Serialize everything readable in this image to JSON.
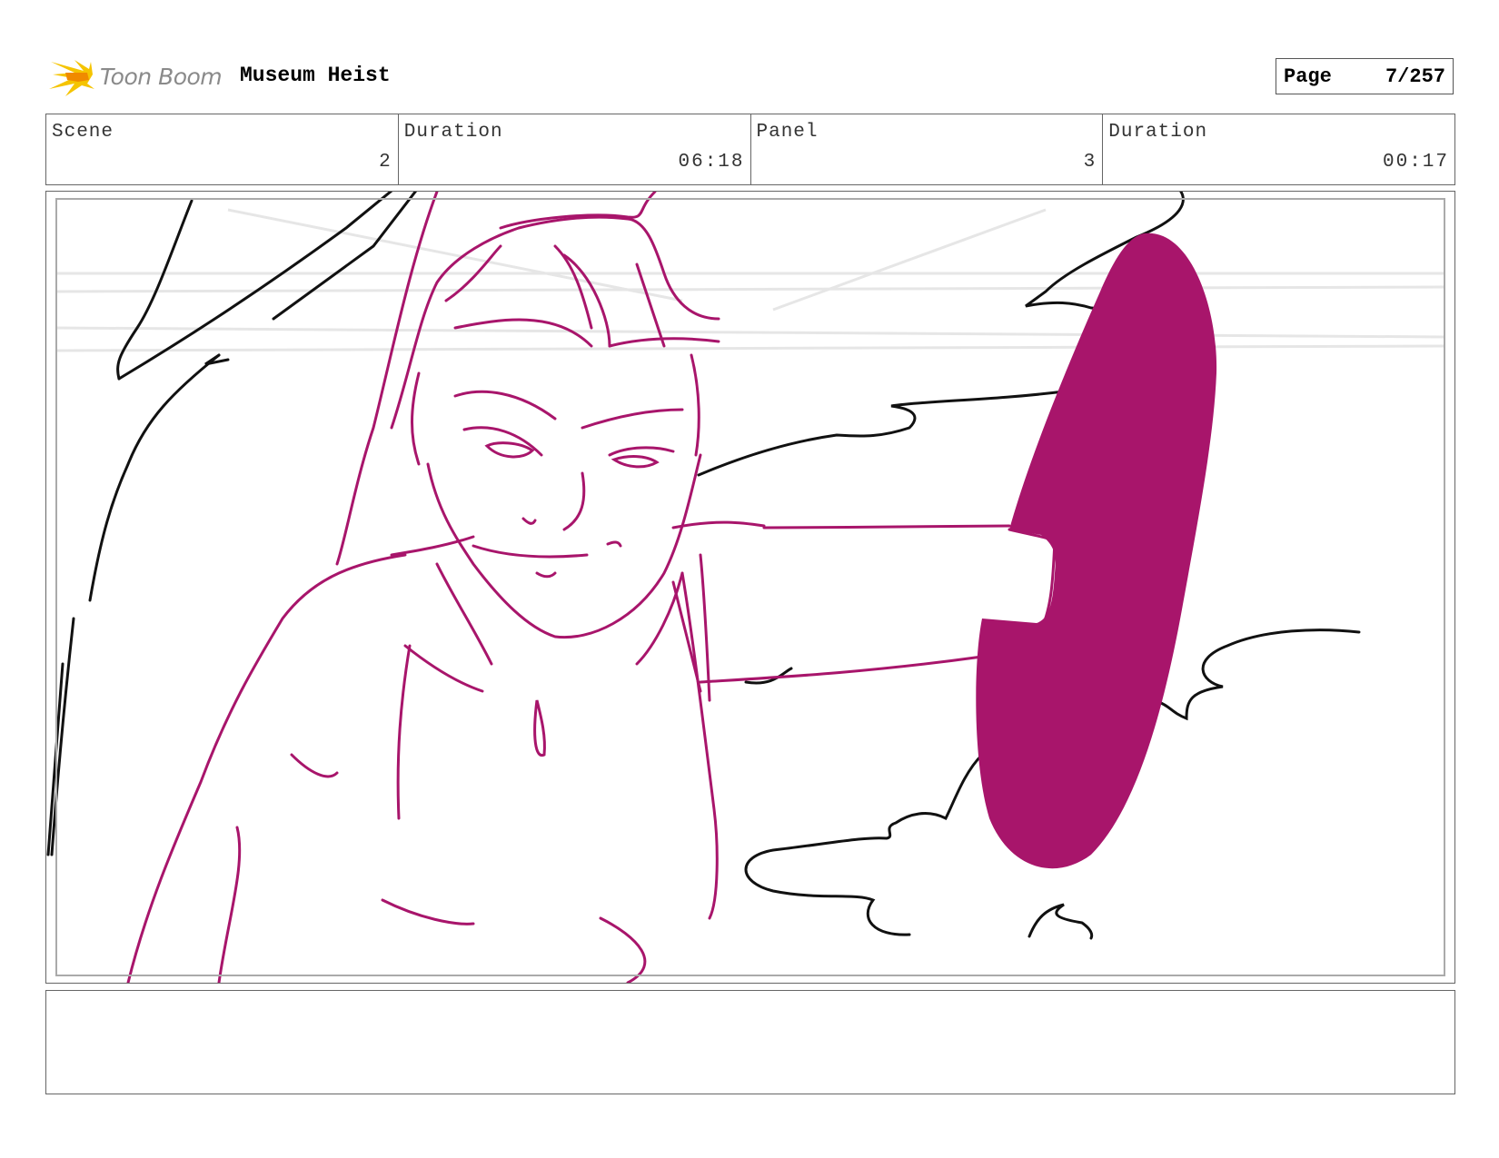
{
  "header": {
    "logo_text": "Toon Boom",
    "project_title": "Museum Heist",
    "page_label": "Page",
    "page_value": "7/257"
  },
  "info": {
    "scene_label": "Scene",
    "scene_value": "2",
    "scene_duration_label": "Duration",
    "scene_duration_value": "06:18",
    "panel_label": "Panel",
    "panel_value": "3",
    "panel_duration_label": "Duration",
    "panel_duration_value": "00:17"
  },
  "colors": {
    "sketch_magenta": "#a8156b",
    "ink_black": "#111111",
    "logo_yellow": "#f5c400",
    "logo_orange": "#f08a00"
  },
  "icons": {
    "logo": "toon-boom-starburst-icon"
  }
}
